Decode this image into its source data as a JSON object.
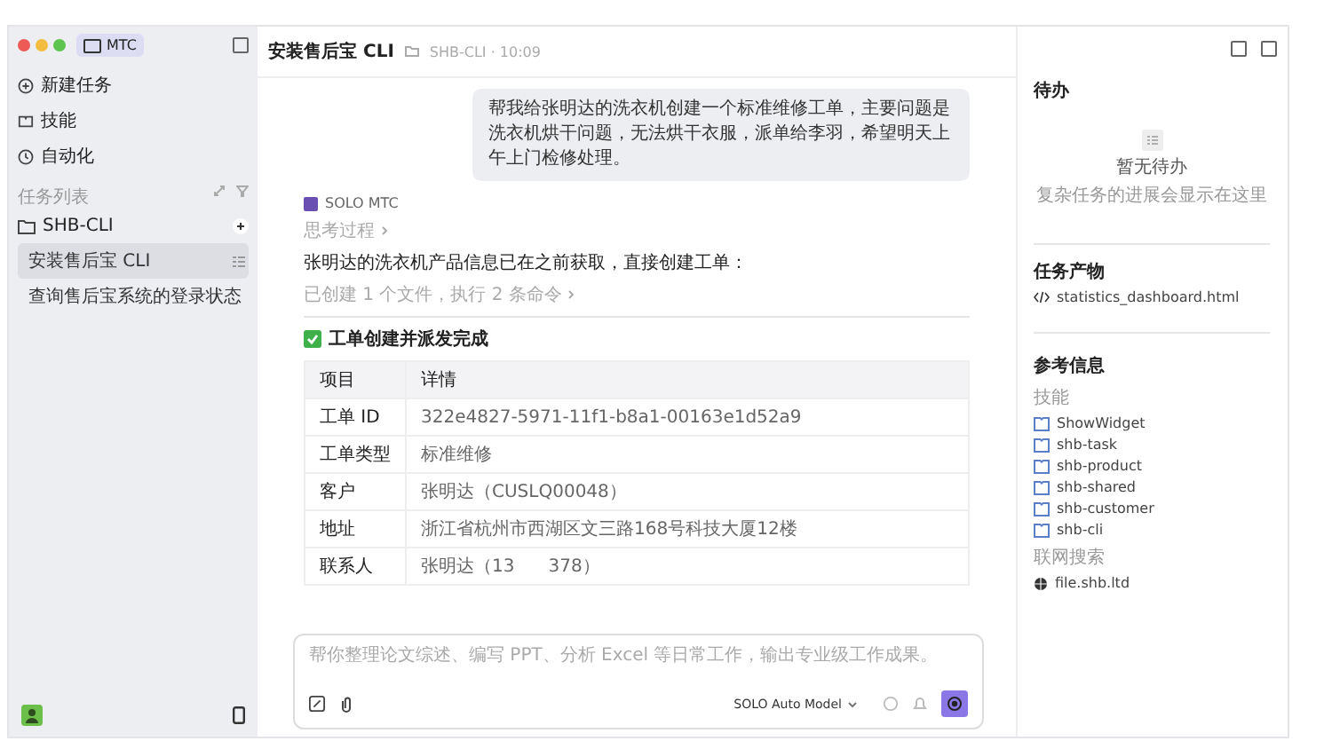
{
  "window": {
    "app_badge": "MTC"
  },
  "sidebar": {
    "nav": [
      {
        "kind": "new",
        "label": "新建任务"
      },
      {
        "kind": "skills",
        "label": "技能"
      },
      {
        "kind": "auto",
        "label": "自动化"
      }
    ],
    "section_label": "任务列表",
    "tree": [
      {
        "label": "SHB-CLI",
        "children": [
          {
            "label": "安装售后宝 CLI",
            "selected": true
          },
          {
            "label": "查询售后宝系统的登录状态",
            "selected": false
          }
        ]
      }
    ]
  },
  "header": {
    "title": "安装售后宝 CLI",
    "meta": "SHB-CLI · 10:09"
  },
  "chat": {
    "user_message": "帮我给张明达的洗衣机创建一个标准维修工单，主要问题是洗衣机烘干问题，无法烘干衣服，派单给李羽，希望明天上午上门检修处理。",
    "assistant": "SOLO MTC",
    "thinking": "思考过程",
    "text": "张明达的洗衣机产品信息已在之前获取，直接创建工单：",
    "steps": "已创建 1 个文件，执行 2 条命令",
    "result_title": "工单创建并派发完成",
    "table": {
      "columns": [
        "项目",
        "详情"
      ],
      "rows": [
        [
          "工单 ID",
          "322e4827-5971-11f1-b8a1-00163e1d52a9"
        ],
        [
          "工单类型",
          "标准维修"
        ],
        [
          "客户",
          "张明达（CUSLQ00048）"
        ],
        [
          "地址",
          "浙江省杭州市西湖区文三路168号科技大厦12楼"
        ],
        [
          "联系人",
          "张明达（13      378）"
        ]
      ]
    }
  },
  "composer": {
    "placeholder": "帮你整理论文综述、编写 PPT、分析 Excel 等日常工作，输出专业级工作成果。",
    "model": "SOLO Auto Model"
  },
  "right_panel": {
    "todo_title": "待办",
    "empty_title": "暂无待办",
    "empty_hint": "复杂任务的进展会显示在这里",
    "artifacts_title": "任务产物",
    "artifacts": [
      "statistics_dashboard.html"
    ],
    "reference_title": "参考信息",
    "skills_label": "技能",
    "skills": [
      "ShowWidget",
      "shb-task",
      "shb-product",
      "shb-shared",
      "shb-customer",
      "shb-cli"
    ],
    "web_label": "联网搜索",
    "web": [
      "file.shb.ltd"
    ]
  }
}
